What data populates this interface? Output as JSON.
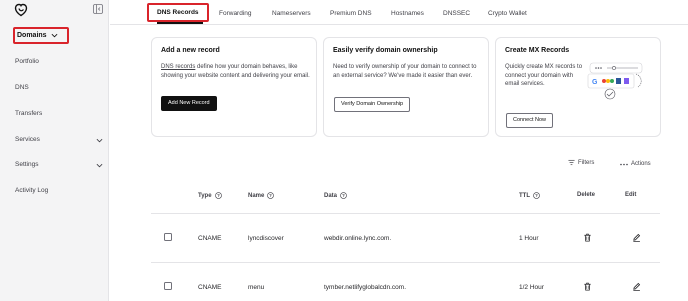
{
  "sidebar": {
    "domains_label": "Domains",
    "items": [
      {
        "label": "Portfolio",
        "has_chevron": false
      },
      {
        "label": "DNS",
        "has_chevron": false
      },
      {
        "label": "Transfers",
        "has_chevron": false
      },
      {
        "label": "Services",
        "has_chevron": true
      },
      {
        "label": "Settings",
        "has_chevron": true
      },
      {
        "label": "Activity Log",
        "has_chevron": false
      }
    ]
  },
  "tabs": [
    {
      "label": "DNS Records",
      "active": true
    },
    {
      "label": "Forwarding",
      "active": false
    },
    {
      "label": "Nameservers",
      "active": false
    },
    {
      "label": "Premium DNS",
      "active": false
    },
    {
      "label": "Hostnames",
      "active": false
    },
    {
      "label": "DNSSEC",
      "active": false
    },
    {
      "label": "Crypto Wallet",
      "active": false
    }
  ],
  "cards": {
    "add": {
      "title": "Add a new record",
      "link_text": "DNS records",
      "text": " define how your domain behaves, like showing your website content and delivering your email.",
      "button": "Add New Record"
    },
    "verify": {
      "title": "Easily verify domain ownership",
      "text": "Need to verify ownership of your domain to connect to an external service? We've made it easier than ever.",
      "button": "Verify Domain Ownership"
    },
    "mx": {
      "title": "Create MX Records",
      "text": "Quickly create MX records to connect your domain with email services.",
      "button": "Connect Now"
    }
  },
  "toolbar": {
    "filters": "Filters",
    "actions": "Actions"
  },
  "table": {
    "headers": {
      "type": "Type",
      "name": "Name",
      "data": "Data",
      "ttl": "TTL",
      "delete": "Delete",
      "edit": "Edit"
    },
    "rows": [
      {
        "type": "CNAME",
        "name": "lyncdiscover",
        "data": "webdir.online.lync.com.",
        "ttl": "1 Hour"
      },
      {
        "type": "CNAME",
        "name": "menu",
        "data": "tymber.netlifyglobalcdn.com.",
        "ttl": "1/2 Hour"
      }
    ]
  },
  "colors": {
    "highlight": "#d9242b",
    "sidebar_bg": "#f4f4f5",
    "button_dark": "#111111"
  }
}
